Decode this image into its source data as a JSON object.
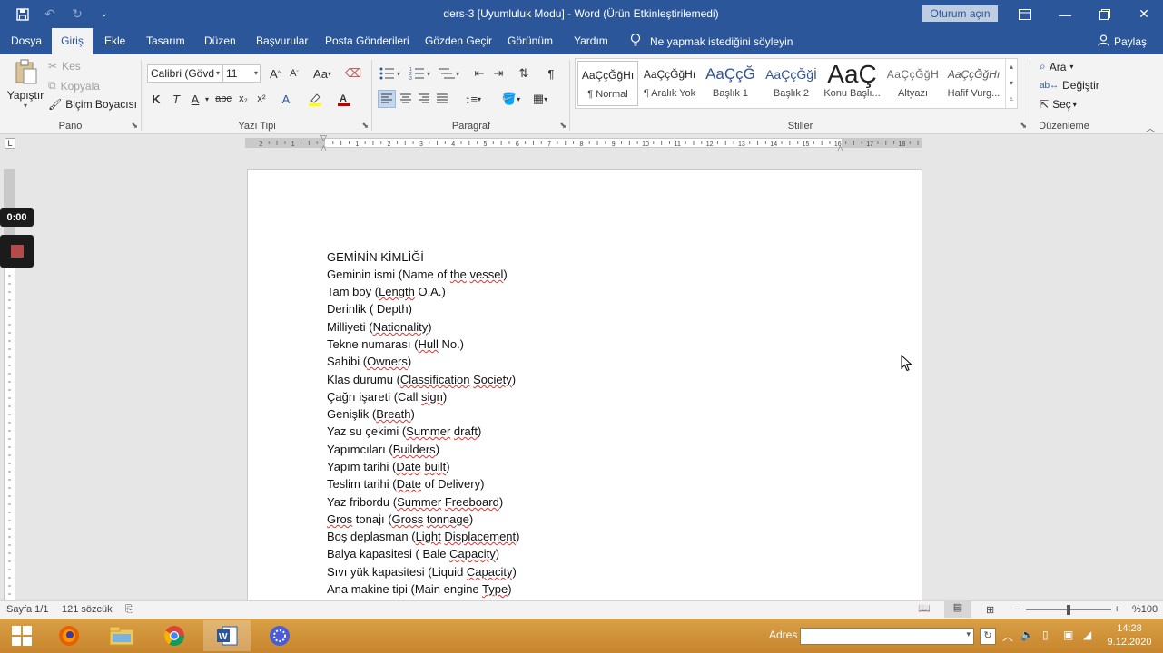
{
  "titlebar": {
    "doc_title": "ders-3 [Uyumluluk Modu]  -  Word (Ürün Etkinleştirilemedi)",
    "signin_label": "Oturum açın"
  },
  "tabs": [
    {
      "label": "Dosya"
    },
    {
      "label": "Giriş"
    },
    {
      "label": "Ekle"
    },
    {
      "label": "Tasarım"
    },
    {
      "label": "Düzen"
    },
    {
      "label": "Başvurular"
    },
    {
      "label": "Posta Gönderileri"
    },
    {
      "label": "Gözden Geçir"
    },
    {
      "label": "Görünüm"
    },
    {
      "label": "Yardım"
    }
  ],
  "tell_me": "Ne yapmak istediğini söyleyin",
  "share_label": "Paylaş",
  "ribbon": {
    "pano": {
      "label": "Pano",
      "paste": "Yapıştır",
      "cut": "Kes",
      "copy": "Kopyala",
      "format_painter": "Biçim Boyacısı"
    },
    "font": {
      "label": "Yazı Tipi",
      "font_name": "Calibri (Gövd",
      "font_size": "11",
      "bold": "K",
      "italic": "T",
      "underline": "A"
    },
    "paragraph": {
      "label": "Paragraf"
    },
    "styles": {
      "label": "Stiller",
      "items": [
        {
          "preview": "AaÇçĞğHı",
          "name": "¶ Normal"
        },
        {
          "preview": "AaÇçĞğHı",
          "name": "¶ Aralık Yok"
        },
        {
          "preview": "AaÇçĞ",
          "name": "Başlık 1"
        },
        {
          "preview": "AaÇçĞğİ",
          "name": "Başlık 2"
        },
        {
          "preview": "AaÇ",
          "name": "Konu Başlı..."
        },
        {
          "preview": "AaÇçĞğH",
          "name": "Altyazı"
        },
        {
          "preview": "AaÇçĞğHı",
          "name": "Hafif Vurg..."
        }
      ]
    },
    "editing": {
      "label": "Düzenleme",
      "find": "Ara",
      "replace": "Değiştir",
      "select": "Seç"
    }
  },
  "document": {
    "lines": [
      "GEMİNİN KİMLİĞİ",
      "Geminin ismi (Name of the vessel)",
      "Tam boy (Length O.A.)",
      "Derinlik ( Depth)",
      "Milliyeti (Nationality)",
      "Tekne numarası (Hull No.)",
      "Sahibi (Owners)",
      "Klas durumu (Classification Society)",
      "Çağrı işareti (Call sign)",
      "Genişlik (Breath)",
      "Yaz su çekimi (Summer draft)",
      "Yapımcıları (Builders)",
      "Yapım tarihi (Date built)",
      "Teslim tarihi (Date of Delivery)",
      "Yaz fribordu (Summer Freeboard)",
      "Gros tonajı (Gross tonnage)",
      "Boş deplasman (Light Displacement)",
      "Balya kapasitesi ( Bale Capacity)",
      "Sıvı yük kapasitesi (Liquid Capacity)",
      "Ana makine tipi (Main engine Type)"
    ]
  },
  "recording": {
    "timer": "0:00"
  },
  "status": {
    "page": "Sayfa 1/1",
    "words": "121 sözcük",
    "zoom": "%100"
  },
  "taskbar": {
    "address_label": "Adres",
    "time": "14:28",
    "date": "9.12.2020"
  }
}
